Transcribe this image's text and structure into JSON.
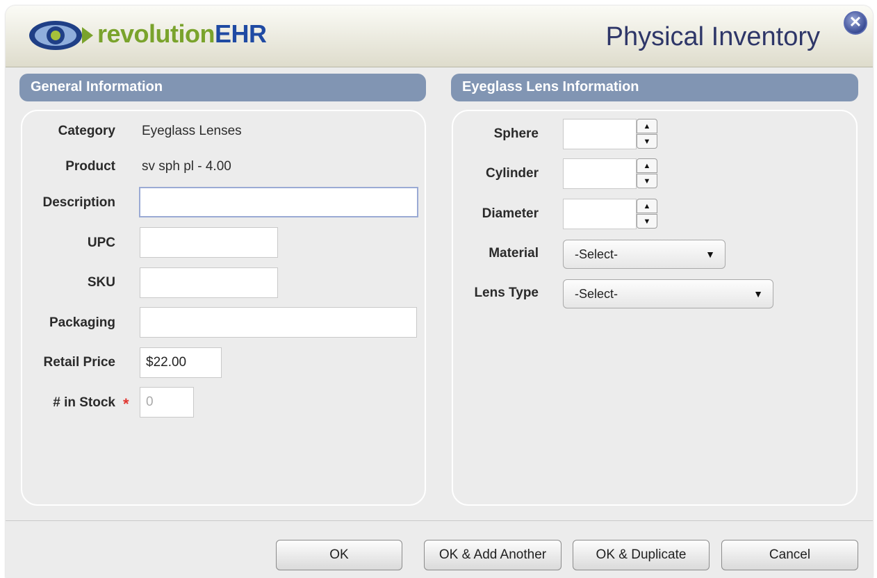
{
  "header": {
    "brand_part1": "revolution",
    "brand_part2": "EHR",
    "title": "Physical Inventory",
    "close_glyph": "✕"
  },
  "general": {
    "title": "General Information",
    "category_label": "Category",
    "category_value": "Eyeglass Lenses",
    "product_label": "Product",
    "product_value": "sv sph pl - 4.00",
    "description_label": "Description",
    "description_value": "",
    "upc_label": "UPC",
    "upc_value": "",
    "sku_label": "SKU",
    "sku_value": "",
    "packaging_label": "Packaging",
    "packaging_value": "",
    "retail_price_label": "Retail Price",
    "retail_price_value": "$22.00",
    "stock_label": "# in Stock",
    "stock_required": "*",
    "stock_value": "0"
  },
  "lens": {
    "title": "Eyeglass Lens Information",
    "sphere_label": "Sphere",
    "sphere_value": "",
    "cylinder_label": "Cylinder",
    "cylinder_value": "",
    "diameter_label": "Diameter",
    "diameter_value": "",
    "material_label": "Material",
    "material_selected": "-Select-",
    "lens_type_label": "Lens Type",
    "lens_type_selected": "-Select-",
    "stepper_up": "▲",
    "stepper_down": "▼",
    "select_arrow": "▼"
  },
  "buttons": {
    "ok": "OK",
    "ok_add_another": "OK & Add Another",
    "ok_duplicate": "OK & Duplicate",
    "cancel": "Cancel"
  },
  "colors": {
    "section_header": "#8195b3",
    "brand_green": "#7aa32c",
    "brand_blue": "#1f4aa3",
    "title": "#2e3668",
    "required": "#e0352f"
  }
}
